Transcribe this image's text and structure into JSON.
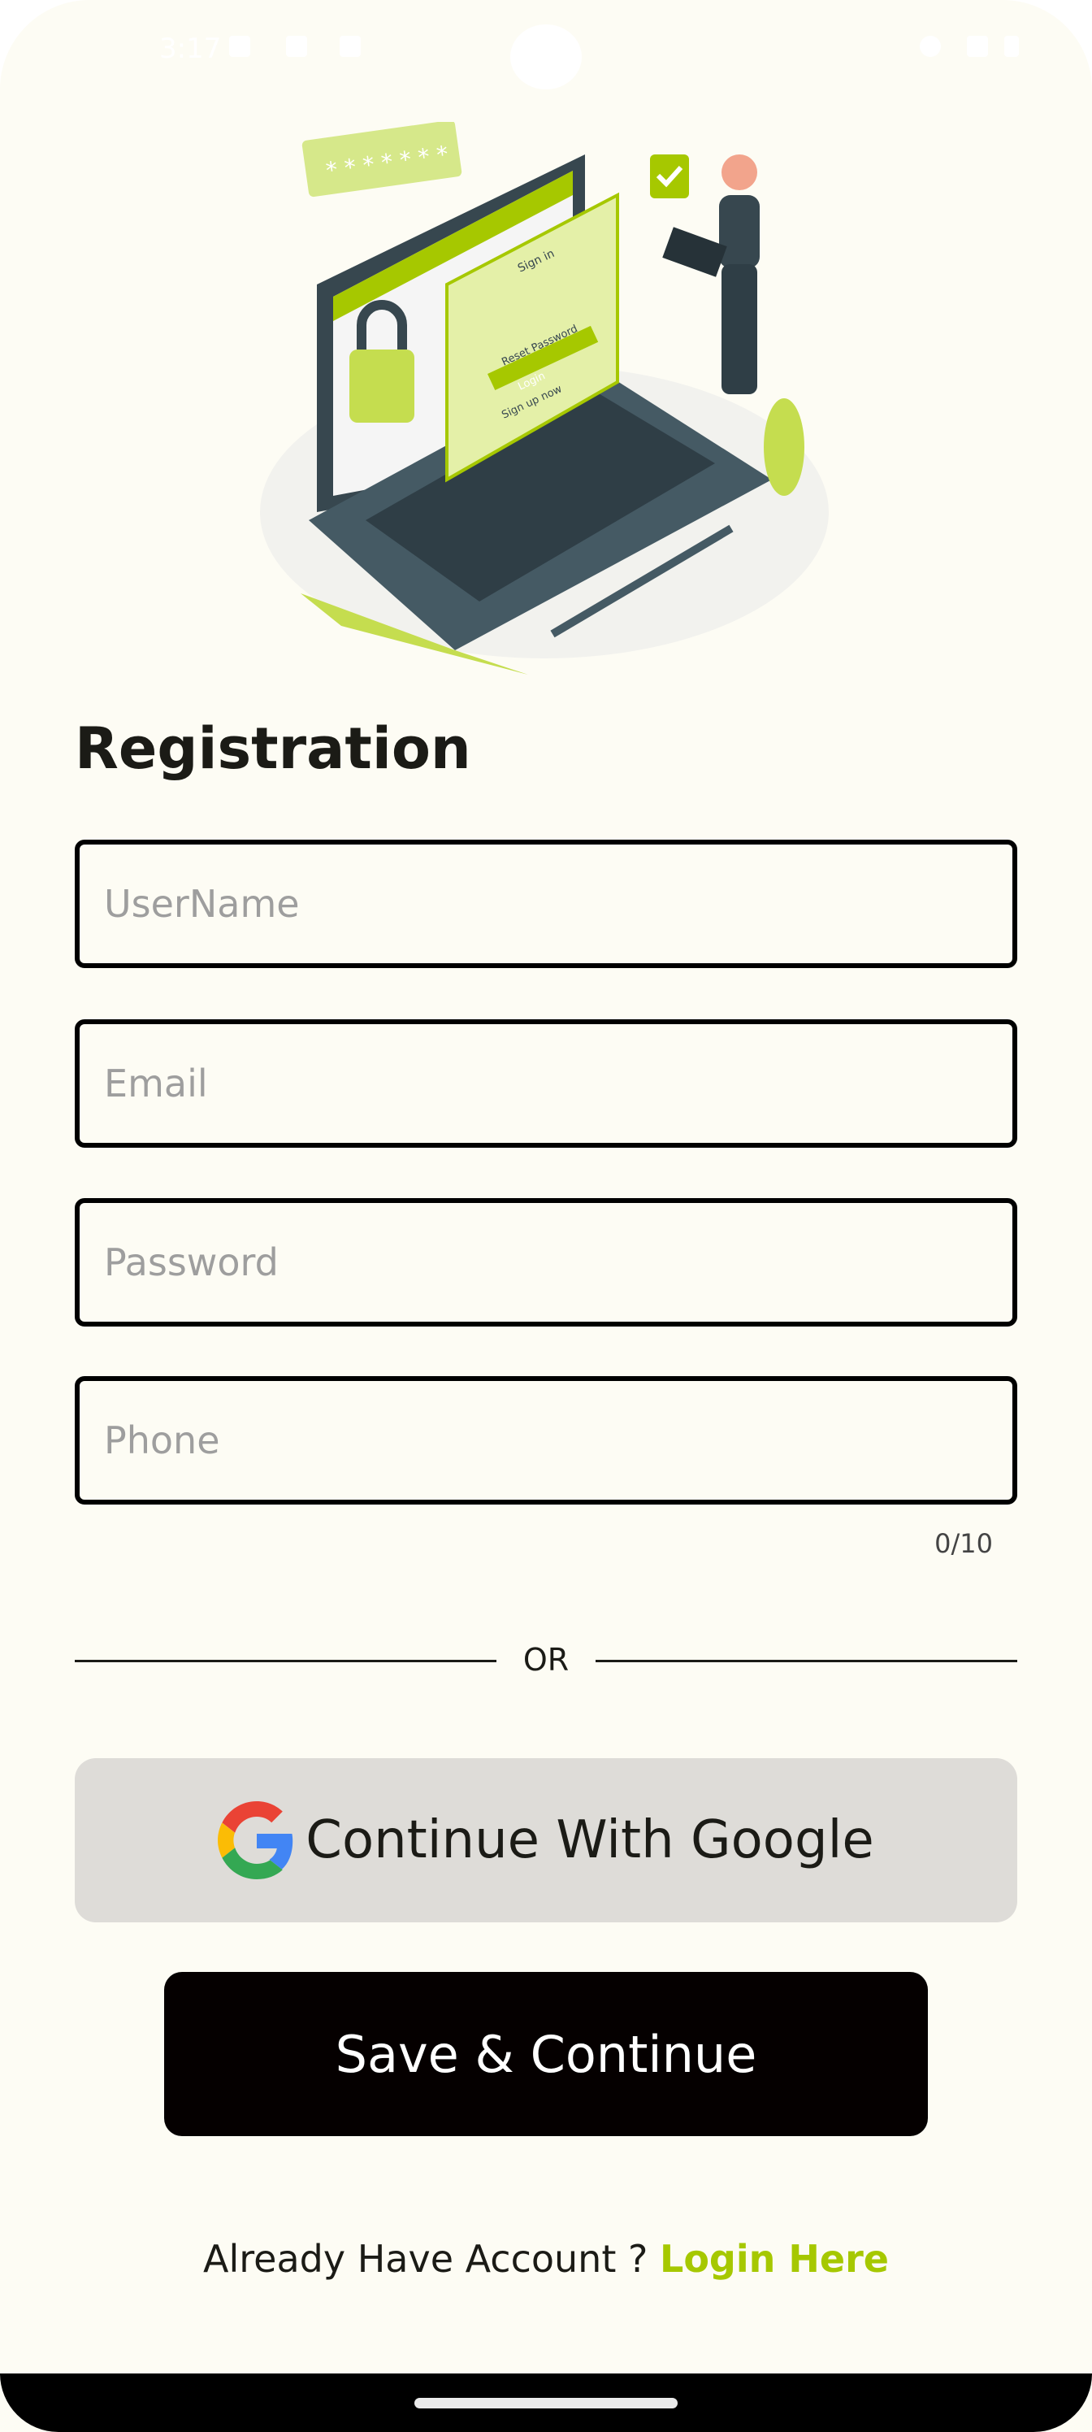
{
  "status_bar": {
    "time": "3:17"
  },
  "page": {
    "title": "Registration"
  },
  "form": {
    "username_placeholder": "UserName",
    "email_placeholder": "Email",
    "password_placeholder": "Password",
    "phone_placeholder": "Phone",
    "phone_counter": "0/10"
  },
  "divider": {
    "label": "OR"
  },
  "google_button": {
    "label": "Continue With Google"
  },
  "save_button": {
    "label": "Save & Continue"
  },
  "footer": {
    "prompt": "Already Have Account ? ",
    "link": "Login Here"
  },
  "illustration": {
    "window_title": "Sign in",
    "login_label": "Login",
    "reset_label": "Reset Password",
    "signup_label": "Sign up now"
  },
  "colors": {
    "accent": "#a6c800",
    "background": "#fdfcf4",
    "google_bg": "#dedcd8",
    "primary": "#050000"
  }
}
